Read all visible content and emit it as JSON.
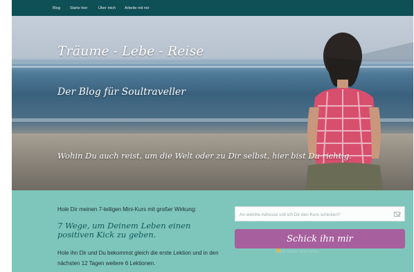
{
  "nav": {
    "items": [
      "Blog",
      "Starte hier",
      "Über mich",
      "Arbeite mit mir"
    ]
  },
  "hero": {
    "title": "Träume - Lebe - Reise",
    "subtitle": "Der Blog für Soultraveller",
    "tagline": "Wohin Du auch reist, um die Welt oder zu Dir selbst, hier bist Du richtig."
  },
  "optin": {
    "intro": "Hole Dir meinen 7-teiligen Mini-Kurs mit großer Wirkung:",
    "course_title": "7 Wege, um Deinem Leben einen positiven Kick zu geben.",
    "description": "Hole ihn Dir und Du bekommst gleich die erste Lektion und in den nächsten 12 Tagen weitere 6 Lektionen.",
    "email_placeholder": "An welche Adresse soll ich Dir den Kurs schicken?",
    "submit_label": "Schick ihn mir",
    "privacy_note": "Deine Daten sind sicher."
  },
  "icons": {
    "mail": "mail-icon",
    "lock": "lock-icon"
  },
  "colors": {
    "nav_bg": "#0f4f56",
    "optin_bg": "#7ec6bc",
    "button_bg": "#a75f9d",
    "course_title": "#0f5a5a"
  }
}
